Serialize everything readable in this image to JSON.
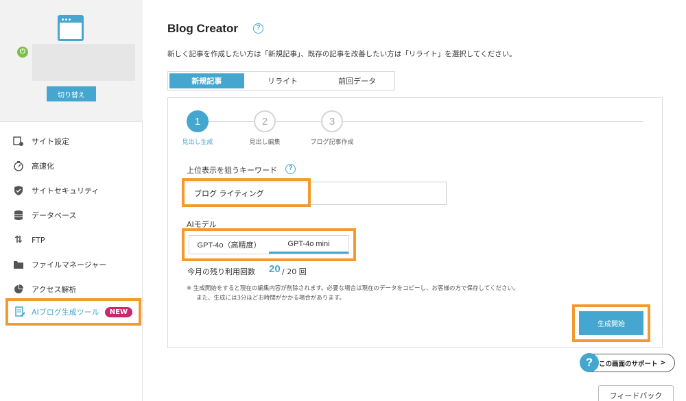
{
  "sidebar": {
    "switch_label": "切り替え",
    "items": [
      {
        "label": "サイト設定",
        "icon": "site-settings-icon"
      },
      {
        "label": "高速化",
        "icon": "speedometer-icon"
      },
      {
        "label": "サイトセキュリティ",
        "icon": "shield-icon"
      },
      {
        "label": "データベース",
        "icon": "database-icon"
      },
      {
        "label": "FTP",
        "icon": "transfer-arrows-icon"
      },
      {
        "label": "ファイルマネージャー",
        "icon": "folder-icon"
      },
      {
        "label": "アクセス解析",
        "icon": "pie-chart-icon"
      }
    ],
    "ai_item": {
      "label": "AIブログ生成ツール",
      "badge": "NEW",
      "icon": "document-edit-icon"
    }
  },
  "main": {
    "title": "Blog Creator",
    "intro": "新しく記事を作成したい方は「新規記事」、既存の記事を改善したい方は「リライト」を選択してください。",
    "tabs": [
      {
        "label": "新規記事",
        "active": true
      },
      {
        "label": "リライト",
        "active": false
      },
      {
        "label": "前回データ",
        "active": false
      }
    ],
    "steps": [
      {
        "num": "1",
        "label": "見出し生成",
        "active": true
      },
      {
        "num": "2",
        "label": "見出し編集",
        "active": false
      },
      {
        "num": "3",
        "label": "ブログ記事作成",
        "active": false
      }
    ],
    "keyword_label": "上位表示を狙うキーワード",
    "keyword_value": "ブログ ライティング",
    "model_label": "AIモデル",
    "models": [
      {
        "label": "GPT-4o（高精度）",
        "selected": false
      },
      {
        "label": "GPT-4o mini",
        "selected": true
      }
    ],
    "usage_label": "今月の残り利用回数",
    "usage_remaining": "20",
    "usage_total": "/ 20 回",
    "notes": [
      "※ 生成開始をすると現在の編集内容が削除されます。必要な場合は現在のデータをコピーし、お客様の方で保存してください。",
      "また、生成には3分ほどお時間がかかる場合があります。"
    ],
    "generate_label": "生成開始"
  },
  "support_label": "この画面のサポート",
  "support_chevron": ">",
  "feedback_label": "フィードバック",
  "colors": {
    "accent": "#45a7cf",
    "highlight": "#f39a2e",
    "badge": "#c8286d",
    "power": "#7cc143"
  }
}
